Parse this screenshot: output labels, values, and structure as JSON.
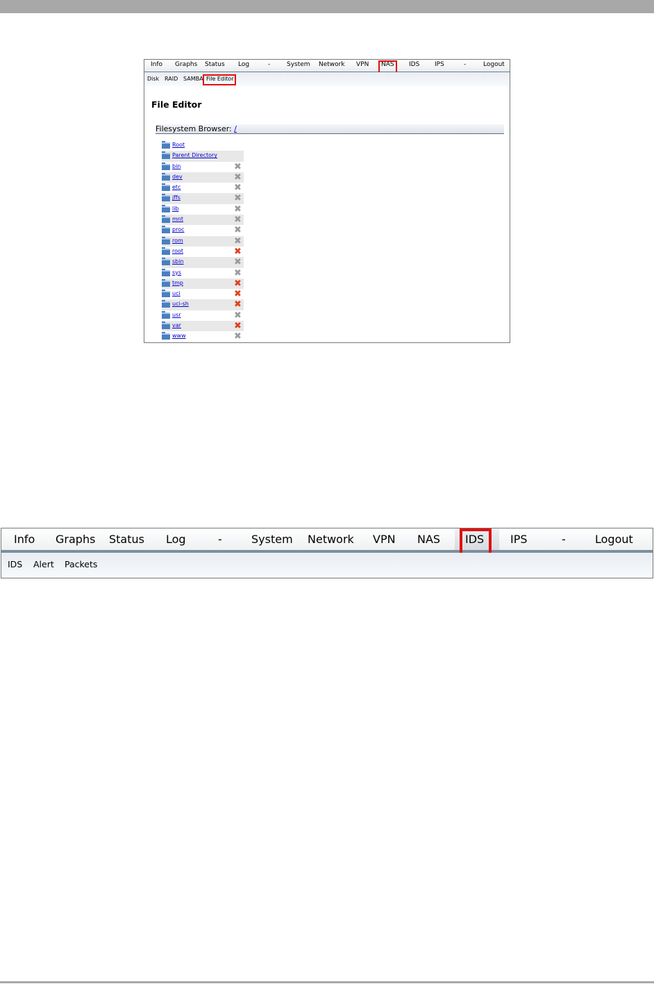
{
  "screenshot1": {
    "nav": [
      "Info",
      "Graphs",
      "Status",
      "Log",
      "-",
      "System",
      "Network",
      "VPN",
      "NAS",
      "IDS",
      "IPS",
      "-",
      "Logout"
    ],
    "subnav": [
      "Disk",
      "RAID",
      "SAMBA",
      "File Editor"
    ],
    "page_title": "File Editor",
    "browser_label": "Filesystem Browser:",
    "browser_path": "/",
    "entries": [
      {
        "name": "Root",
        "delete": "none"
      },
      {
        "name": "Parent Directory",
        "delete": "none"
      },
      {
        "name": "bin",
        "delete": "grey"
      },
      {
        "name": "dev",
        "delete": "grey"
      },
      {
        "name": "etc",
        "delete": "grey"
      },
      {
        "name": "jffs",
        "delete": "grey"
      },
      {
        "name": "lib",
        "delete": "grey"
      },
      {
        "name": "mnt",
        "delete": "grey"
      },
      {
        "name": "proc",
        "delete": "grey"
      },
      {
        "name": "rom",
        "delete": "grey"
      },
      {
        "name": "root",
        "delete": "red"
      },
      {
        "name": "sbin",
        "delete": "grey"
      },
      {
        "name": "sys",
        "delete": "grey"
      },
      {
        "name": "tmp",
        "delete": "red"
      },
      {
        "name": "uci",
        "delete": "red"
      },
      {
        "name": "uci-sh",
        "delete": "red"
      },
      {
        "name": "usr",
        "delete": "grey"
      },
      {
        "name": "var",
        "delete": "red"
      },
      {
        "name": "www",
        "delete": "grey"
      }
    ]
  },
  "screenshot2": {
    "nav": [
      "Info",
      "Graphs",
      "Status",
      "Log",
      "-",
      "System",
      "Network",
      "VPN",
      "NAS",
      "IDS",
      "IPS",
      "-",
      "Logout"
    ],
    "subnav": [
      "IDS",
      "Alert",
      "Packets"
    ]
  },
  "colors": {
    "highlight": "#e01010",
    "link": "#0000cc",
    "delete_red": "#e0401a",
    "delete_grey": "#9a9a9a"
  }
}
